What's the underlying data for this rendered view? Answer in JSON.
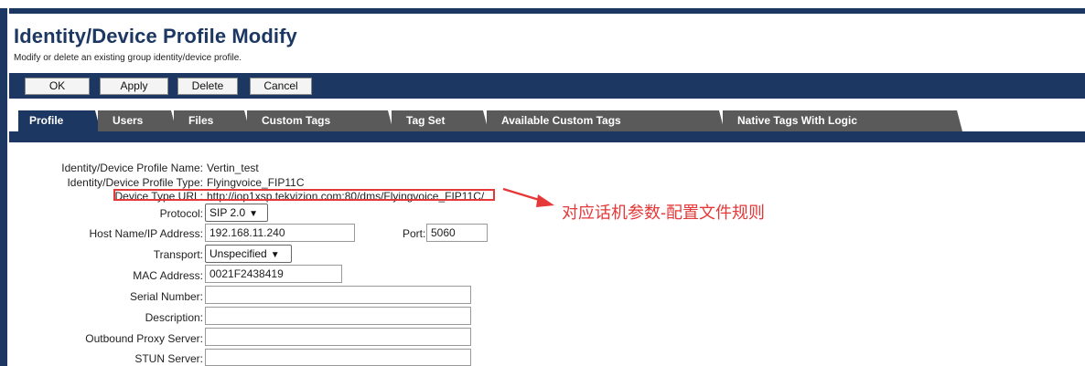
{
  "page": {
    "title": "Identity/Device Profile Modify",
    "subtitle": "Modify or delete an existing group identity/device profile."
  },
  "toolbar": {
    "ok_label": "OK",
    "apply_label": "Apply",
    "delete_label": "Delete",
    "cancel_label": "Cancel"
  },
  "tabs": [
    {
      "label": "Profile",
      "active": true
    },
    {
      "label": "Users",
      "active": false
    },
    {
      "label": "Files",
      "active": false
    },
    {
      "label": "Custom Tags",
      "active": false
    },
    {
      "label": "Tag Set",
      "active": false
    },
    {
      "label": "Available Custom Tags",
      "active": false
    },
    {
      "label": "Native Tags With Logic",
      "active": false
    }
  ],
  "form": {
    "profile_name": {
      "label": "Identity/Device Profile Name:",
      "value": "Vertin_test"
    },
    "profile_type": {
      "label": "Identity/Device Profile Type:",
      "value": "Flyingvoice_FIP11C"
    },
    "device_type_url": {
      "label": "Device Type URL:",
      "value": "http://iop1xsp.tekvizion.com:80/dms/Flyingvoice_FIP11C/"
    },
    "protocol": {
      "label": "Protocol:",
      "value": "SIP 2.0"
    },
    "host": {
      "label": "Host Name/IP Address:",
      "value": "192.168.11.240"
    },
    "port": {
      "label": "Port:",
      "value": "5060"
    },
    "transport": {
      "label": "Transport:",
      "value": "Unspecified"
    },
    "mac": {
      "label": "MAC Address:",
      "value": "0021F2438419"
    },
    "serial": {
      "label": "Serial Number:",
      "value": ""
    },
    "description": {
      "label": "Description:",
      "value": ""
    },
    "outbound_proxy": {
      "label": "Outbound Proxy Server:",
      "value": ""
    },
    "stun": {
      "label": "STUN Server:",
      "value": ""
    }
  },
  "annotation": {
    "text": "对应话机参数-配置文件规则",
    "color": "#e53838"
  },
  "colors": {
    "navy": "#1c3761",
    "tab_inactive": "#5a5a5a"
  }
}
